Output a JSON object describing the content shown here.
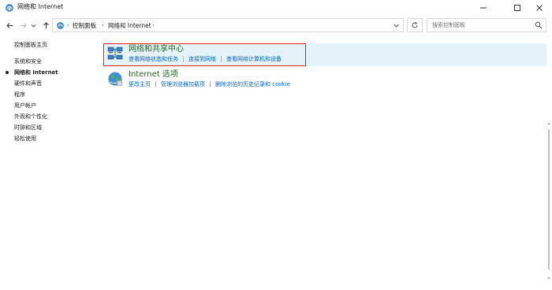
{
  "window": {
    "title": "网络和 Internet",
    "app_icon": "control-panel-icon",
    "controls": [
      "minimize-icon",
      "maximize-icon",
      "close-icon"
    ]
  },
  "address_bar": {
    "breadcrumbs": [
      "控制面板",
      "网络和 Internet"
    ],
    "search_placeholder": "搜索控制面板"
  },
  "left_nav": {
    "home": "控制面板主页",
    "items": [
      {
        "label": "系统和安全",
        "current": false
      },
      {
        "label": "网络和 Internet",
        "current": true
      },
      {
        "label": "硬件和声音",
        "current": false
      },
      {
        "label": "程序",
        "current": false
      },
      {
        "label": "用户帐户",
        "current": false
      },
      {
        "label": "外观和个性化",
        "current": false
      },
      {
        "label": "时钟和区域",
        "current": false
      },
      {
        "label": "轻松使用",
        "current": false
      }
    ]
  },
  "categories": [
    {
      "title": "网络和共享中心",
      "icon": "network-sharing-center-icon",
      "links": [
        "查看网络状态和任务",
        "连接到网络",
        "查看网络计算机和设备"
      ]
    },
    {
      "title": "Internet 选项",
      "icon": "internet-options-globe-icon",
      "links": [
        "更改主页",
        "管理浏览器加载项",
        "删除浏览的历史记录和 cookie"
      ]
    }
  ],
  "colors": {
    "highlight_border": "#e02020",
    "category_hover_bg": "#e5f3fb",
    "category_title": "#1e6b1e",
    "link": "#0066cc"
  }
}
